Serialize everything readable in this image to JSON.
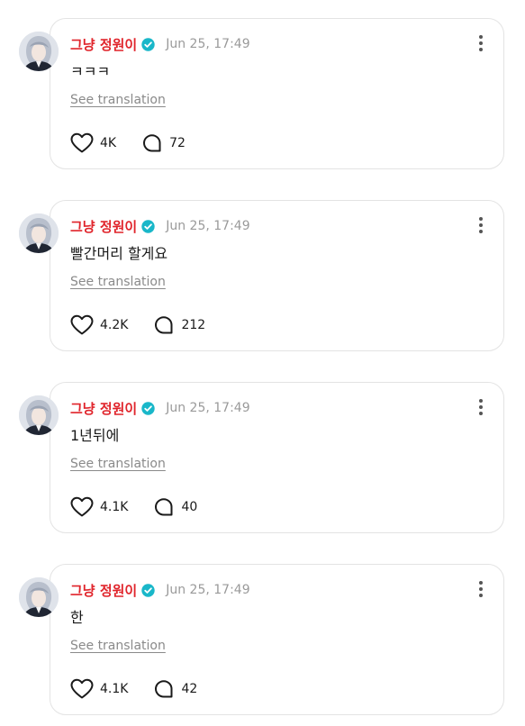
{
  "posts": [
    {
      "author": "그냥 정원이",
      "time": "Jun 25, 17:49",
      "text": "ㅋㅋㅋ",
      "translate_label": "See translation",
      "likes": "4K",
      "comments": "72"
    },
    {
      "author": "그냥 정원이",
      "time": "Jun 25, 17:49",
      "text": "빨간머리 할게요",
      "translate_label": "See translation",
      "likes": "4.2K",
      "comments": "212"
    },
    {
      "author": "그냥 정원이",
      "time": "Jun 25, 17:49",
      "text": "1년뒤에",
      "translate_label": "See translation",
      "likes": "4.1K",
      "comments": "40"
    },
    {
      "author": "그냥 정원이",
      "time": "Jun 25, 17:49",
      "text": "한",
      "translate_label": "See translation",
      "likes": "4.1K",
      "comments": "42"
    }
  ],
  "icons": {
    "verified": "verified-badge-icon",
    "more": "more-options-icon",
    "like": "heart-icon",
    "comment": "comment-bubble-icon"
  },
  "colors": {
    "author": "#e0242b",
    "verified": "#19b7c9",
    "timestamp": "#9a9a9a",
    "card_border": "#e3e3e3"
  }
}
